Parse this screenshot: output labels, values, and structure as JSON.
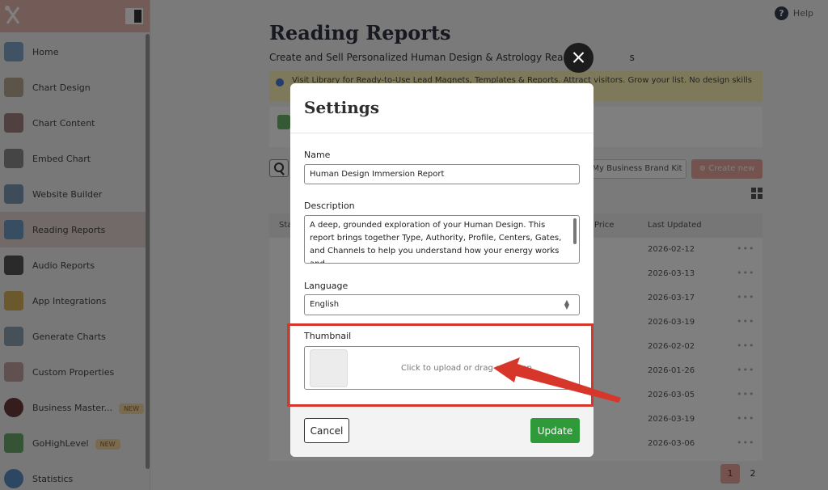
{
  "sidebar": {
    "items": [
      {
        "label": "Home",
        "badge": ""
      },
      {
        "label": "Chart Design",
        "badge": ""
      },
      {
        "label": "Chart Content",
        "badge": ""
      },
      {
        "label": "Embed Chart",
        "badge": ""
      },
      {
        "label": "Website Builder",
        "badge": ""
      },
      {
        "label": "Reading Reports",
        "badge": ""
      },
      {
        "label": "Audio Reports",
        "badge": ""
      },
      {
        "label": "App Integrations",
        "badge": ""
      },
      {
        "label": "Generate Charts",
        "badge": ""
      },
      {
        "label": "Custom Properties",
        "badge": ""
      },
      {
        "label": "Business Master...",
        "badge": "NEW"
      },
      {
        "label": "GoHighLevel",
        "badge": "NEW"
      },
      {
        "label": "Statistics",
        "badge": ""
      }
    ],
    "active_index": 5
  },
  "header": {
    "help_label": "Help",
    "title": "Reading Reports",
    "subtitle": "Create and Sell Personalized Human Design & Astrology Reading",
    "subtitle_tail": "s",
    "banner": "Visit Library for Ready-to-Use Lead Magnets, Templates & Reports. Attract visitors. Grow your list. No design skills"
  },
  "toolbar": {
    "brand_kit_label": "My Business Brand Kit",
    "create_label": "⊕ Create new"
  },
  "table": {
    "headers": {
      "status": "Sta",
      "price": "Price",
      "updated": "Last Updated"
    },
    "rows": [
      {
        "updated": "2026-02-12"
      },
      {
        "updated": "2026-03-13"
      },
      {
        "updated": "2026-03-17"
      },
      {
        "updated": "2026-03-19"
      },
      {
        "updated": "2026-02-02"
      },
      {
        "updated": "2026-01-26"
      },
      {
        "updated": "2026-03-05"
      },
      {
        "updated": "2026-03-19"
      },
      {
        "updated": "2026-03-06"
      }
    ],
    "actions_glyph": "•••"
  },
  "pagination": {
    "pages": [
      "1",
      "2"
    ],
    "current": "1"
  },
  "modal": {
    "title": "Settings",
    "name_label": "Name",
    "name_value": "Human Design Immersion Report",
    "description_label": "Description",
    "description_value": "A deep, grounded exploration of your Human Design. This report brings together Type, Authority, Profile, Centers, Gates, and Channels to help you understand how your energy works and",
    "language_label": "Language",
    "language_value": "English",
    "thumbnail_label": "Thumbnail",
    "upload_text": "Click to upload or drag and drop",
    "cancel_label": "Cancel",
    "update_label": "Update"
  },
  "colors": {
    "accent_red": "#d7372b",
    "update_green": "#2e9a3a",
    "sidebar_header": "#e7b9b0"
  }
}
